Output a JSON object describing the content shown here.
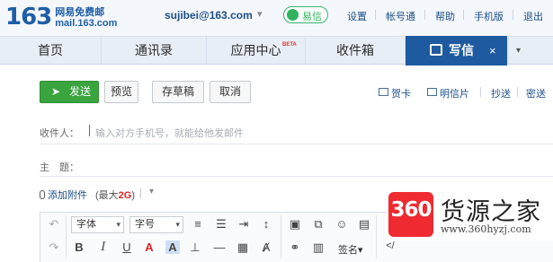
{
  "brand": {
    "logo_number": "163",
    "logo_name": "网易免费邮",
    "logo_domain": "mail.163.com"
  },
  "header": {
    "user_email": "sujibei@163.com",
    "yixin_label": "易信",
    "links": [
      "设置",
      "帐号通",
      "帮助",
      "手机版",
      "退出"
    ]
  },
  "tabs": {
    "items": [
      "首页",
      "通讯录",
      "应用中心",
      "收件箱"
    ],
    "app_center_badge": "BETA",
    "active": {
      "label": "写信",
      "close": "×"
    },
    "more": "▾"
  },
  "toolbar": {
    "send": "发送",
    "preview": "预览",
    "save_draft": "存草稿",
    "cancel": "取消",
    "greeting_card": "贺卡",
    "postcard": "明信片",
    "cc": "抄送",
    "bcc": "密送"
  },
  "compose": {
    "recipients_label": "收件人：",
    "recipients_placeholder": "输入对方手机号，就能给他发邮件",
    "subject_label": "主　题：",
    "attach_label": "添加附件",
    "attach_limit_prefix": "(最大",
    "attach_limit_value": "2G",
    "attach_limit_suffix": ")"
  },
  "editor": {
    "font_family": "字体",
    "font_size": "字号",
    "signature": "签名▾"
  },
  "watermark": {
    "badge": "360",
    "title": "货源之家",
    "url": "www.360hyzj.com"
  },
  "colors": {
    "primary": "#1e5aa0",
    "send_green": "#3aa43f",
    "watermark_red": "#ef2a31"
  }
}
